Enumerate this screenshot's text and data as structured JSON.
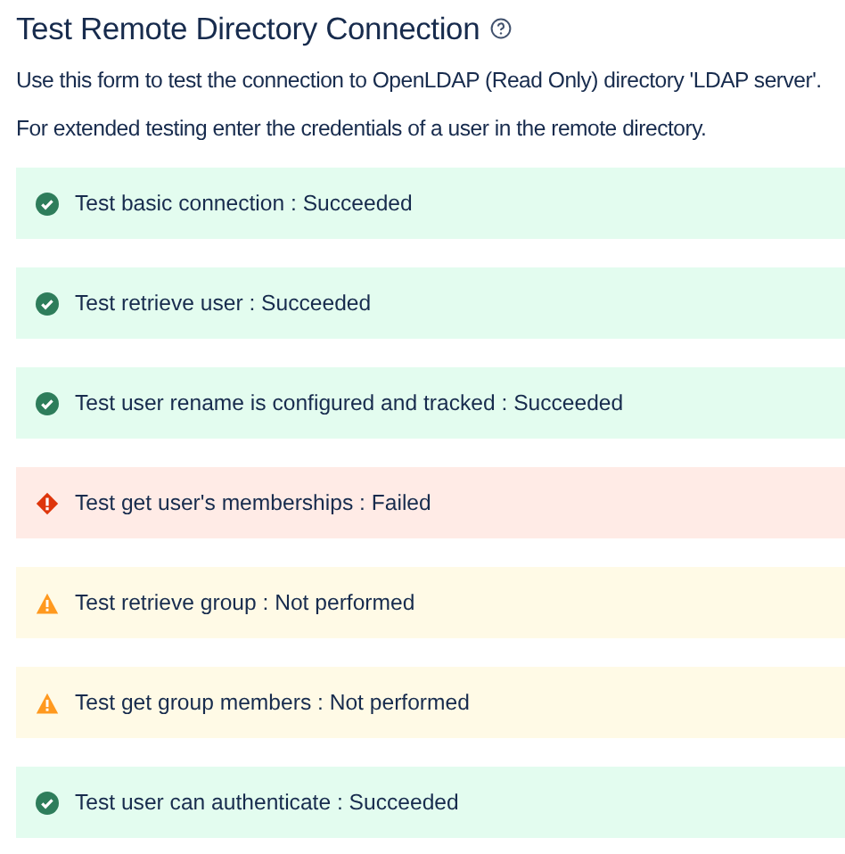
{
  "title": "Test Remote Directory Connection",
  "paragraphs": [
    "Use this form to test the connection to OpenLDAP (Read Only) directory 'LDAP server'.",
    "For extended testing enter the credentials of a user in the remote directory."
  ],
  "results": [
    {
      "kind": "success",
      "text": "Test basic connection : Succeeded"
    },
    {
      "kind": "success",
      "text": "Test retrieve user : Succeeded"
    },
    {
      "kind": "success",
      "text": "Test user rename is configured and tracked : Succeeded"
    },
    {
      "kind": "error",
      "text": "Test get user's memberships : Failed"
    },
    {
      "kind": "warning",
      "text": "Test retrieve group : Not performed"
    },
    {
      "kind": "warning",
      "text": "Test get group members : Not performed"
    },
    {
      "kind": "success",
      "text": "Test user can authenticate : Succeeded"
    }
  ]
}
